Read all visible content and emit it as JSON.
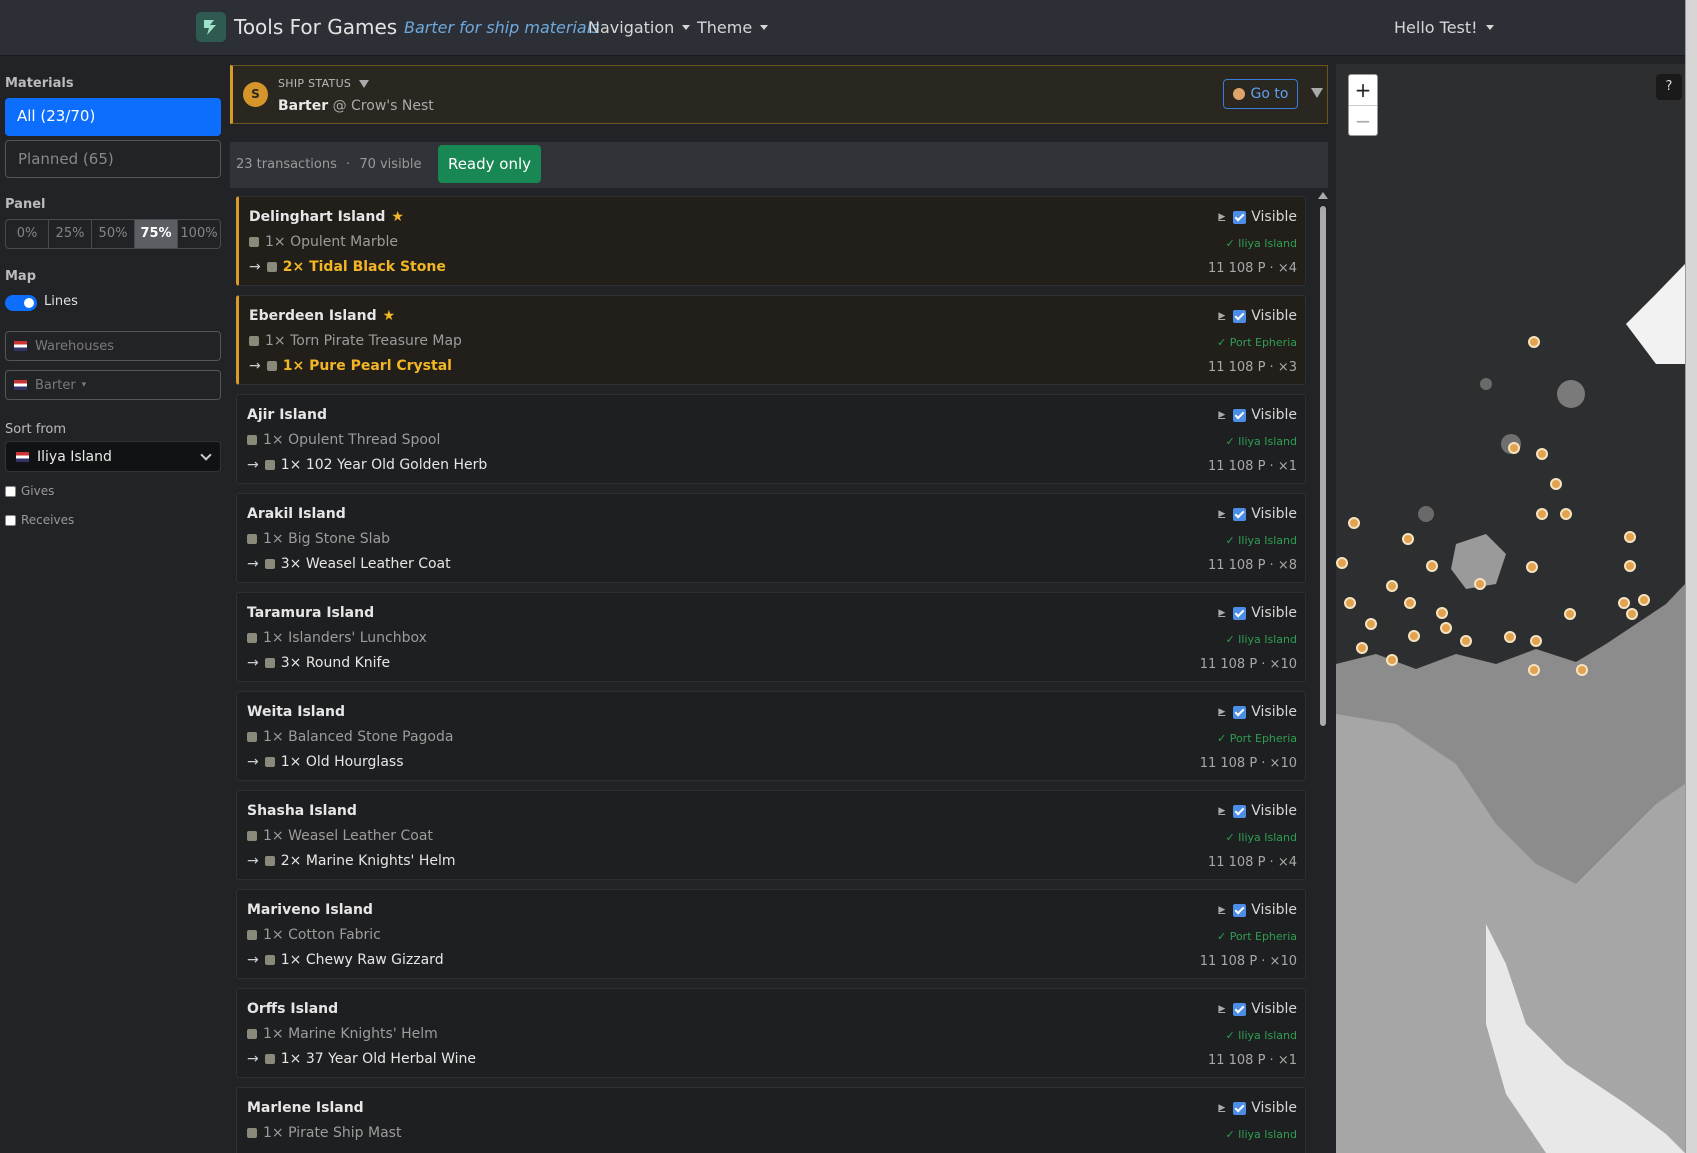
{
  "nav": {
    "brand": "Tools For Games",
    "active": "Barter for ship materials",
    "navigation": "Navigation",
    "theme": "Theme",
    "user": "Hello Test!"
  },
  "sidebar": {
    "materials_title": "Materials",
    "all_label": "All (23/70)",
    "planned_label": "Planned (65)",
    "panel_title": "Panel",
    "panel_options": [
      "0%",
      "25%",
      "50%",
      "75%",
      "100%"
    ],
    "panel_selected": "75%",
    "map_title": "Map",
    "lines_label": "Lines",
    "lines_on": true,
    "warehouses_placeholder": "Warehouses",
    "barter_placeholder": "Barter",
    "sort_title": "Sort from",
    "sort_value": "Iliya Island",
    "gives_label": "Gives",
    "receives_label": "Receives"
  },
  "ship": {
    "badge": "S",
    "label": "SHIP STATUS",
    "activity": "Barter",
    "at": "@",
    "location": "Crow's Nest",
    "goto_label": "Go to"
  },
  "summary": {
    "transactions": "23 transactions",
    "separator": "·",
    "visible": "70 visible",
    "ready_label": "Ready only"
  },
  "cards": [
    {
      "island": "Delinghart Island",
      "starred": true,
      "give": "1× Opulent Marble",
      "get": "2× Tidal Black Stone",
      "visible_label": "Visible",
      "location": "✓ Iliya Island",
      "price": "11 108 P · ×4"
    },
    {
      "island": "Eberdeen Island",
      "starred": true,
      "give": "1× Torn Pirate Treasure Map",
      "get": "1× Pure Pearl Crystal",
      "visible_label": "Visible",
      "location": "✓ Port Epheria",
      "price": "11 108 P · ×3"
    },
    {
      "island": "Ajir Island",
      "starred": false,
      "give": "1× Opulent Thread Spool",
      "get": "1× 102 Year Old Golden Herb",
      "visible_label": "Visible",
      "location": "✓ Iliya Island",
      "price": "11 108 P · ×1"
    },
    {
      "island": "Arakil Island",
      "starred": false,
      "give": "1× Big Stone Slab",
      "get": "3× Weasel Leather Coat",
      "visible_label": "Visible",
      "location": "✓ Iliya Island",
      "price": "11 108 P · ×8"
    },
    {
      "island": "Taramura Island",
      "starred": false,
      "give": "1× Islanders' Lunchbox",
      "get": "3× Round Knife",
      "visible_label": "Visible",
      "location": "✓ Iliya Island",
      "price": "11 108 P · ×10"
    },
    {
      "island": "Weita Island",
      "starred": false,
      "give": "1× Balanced Stone Pagoda",
      "get": "1× Old Hourglass",
      "visible_label": "Visible",
      "location": "✓ Port Epheria",
      "price": "11 108 P · ×10"
    },
    {
      "island": "Shasha Island",
      "starred": false,
      "give": "1× Weasel Leather Coat",
      "get": "2× Marine Knights' Helm",
      "visible_label": "Visible",
      "location": "✓ Iliya Island",
      "price": "11 108 P · ×4"
    },
    {
      "island": "Mariveno Island",
      "starred": false,
      "give": "1× Cotton Fabric",
      "get": "1× Chewy Raw Gizzard",
      "visible_label": "Visible",
      "location": "✓ Port Epheria",
      "price": "11 108 P · ×10"
    },
    {
      "island": "Orffs Island",
      "starred": false,
      "give": "1× Marine Knights' Helm",
      "get": "1× 37 Year Old Herbal Wine",
      "visible_label": "Visible",
      "location": "✓ Iliya Island",
      "price": "11 108 P · ×1"
    },
    {
      "island": "Marlene Island",
      "starred": false,
      "give": "1× Pirate Ship Mast",
      "get": "",
      "visible_label": "Visible",
      "location": "✓ Iliya Island",
      "price": ""
    }
  ],
  "map": {
    "zoom_in": "+",
    "zoom_out": "−",
    "help": "?",
    "marker_color": "#e3a24e"
  }
}
